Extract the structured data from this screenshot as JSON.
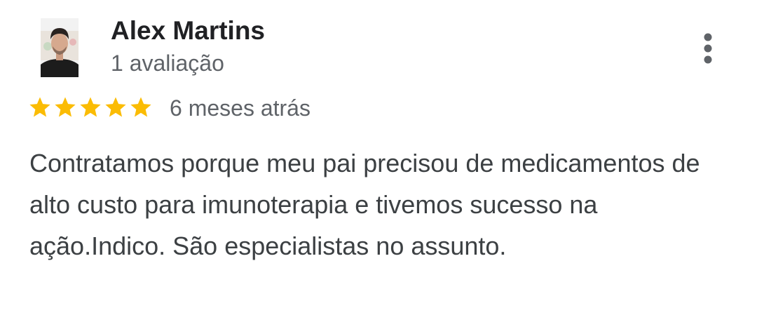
{
  "review": {
    "reviewer_name": "Alex Martins",
    "review_count": "1 avaliação",
    "rating": 5,
    "rating_max": 5,
    "date": "6 meses atrás",
    "text": "Contratamos porque meu pai precisou de medicamentos de alto custo para imunoterapia e tivemos sucesso na ação.Indico. São especialistas no assunto."
  },
  "icons": {
    "more": "more-vert-icon",
    "star": "star-icon"
  },
  "colors": {
    "star": "#fbbc04",
    "name": "#202124",
    "secondary_text": "#5f6368",
    "body_text": "#3c4043",
    "more_icon": "#5f6368"
  }
}
